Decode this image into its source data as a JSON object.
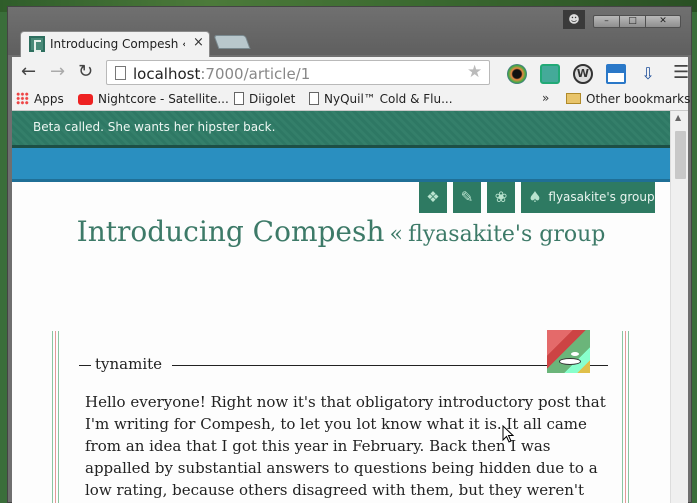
{
  "window": {
    "tab_title": "Introducing Compesh « fly",
    "tab_close": "×"
  },
  "toolbar": {
    "url_host": "localhost",
    "url_path": ":7000/article/1",
    "ext_3_label": "W"
  },
  "bookmarks": {
    "items": [
      {
        "label": "Apps",
        "icon": "apps-grid-icon"
      },
      {
        "label": "Nightcore - Satellite...",
        "icon": "youtube-icon"
      },
      {
        "label": "Diigolet",
        "icon": "page-icon"
      },
      {
        "label": "NyQuil™ Cold & Flu...",
        "icon": "page-icon"
      }
    ],
    "more": "»",
    "other": "Other bookmarks"
  },
  "page": {
    "banner_text": "Beta called. She wants her hipster back.",
    "nav_group_label": "flyasakite's group",
    "title_main": "Introducing Compesh",
    "title_sep": "«",
    "title_group": "flyasakite's group",
    "author": "tynamite",
    "body": "Hello everyone! Right now it's that obligatory introductory post that I'm writing for Compesh, to let you lot know what it is. It all came from an idea that I got this year in February. Back then I was appalled by substantial answers to questions being hidden due to a low rating, because others disagreed with them, but they weren't adjusted or"
  },
  "colors": {
    "banner": "#2e7864",
    "blue_bar": "#2a8fc0",
    "nav_button": "#2e7a62",
    "title": "#3d7a68"
  }
}
